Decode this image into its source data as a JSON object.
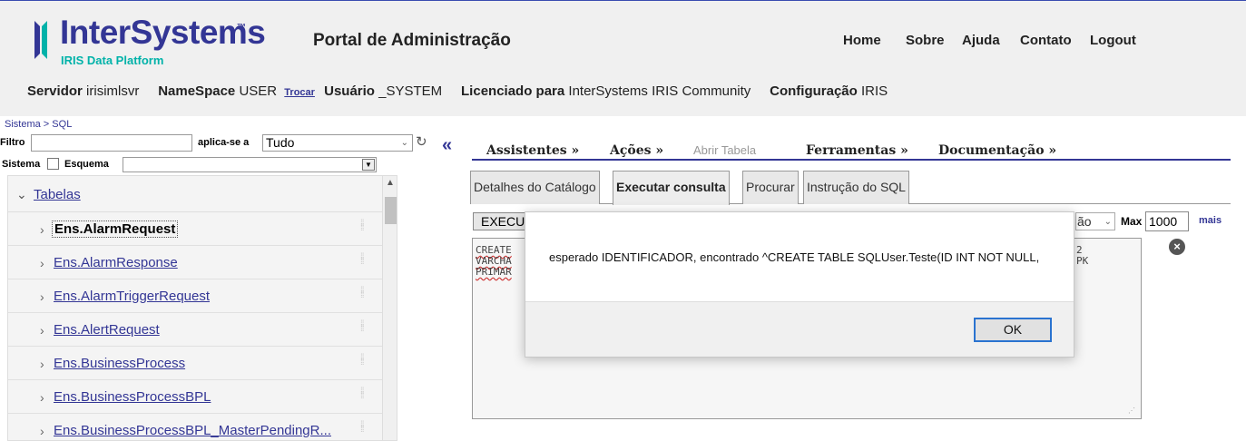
{
  "header": {
    "logo_text": "InterSystems",
    "logo_tm": "™",
    "logo_sub": "IRIS Data Platform",
    "portal_title": "Portal de Administração",
    "nav": [
      "Home",
      "Sobre",
      "Ajuda",
      "Contato",
      "Logout"
    ]
  },
  "infobar": {
    "servidor_label": "Servidor",
    "servidor_value": "irisimlsvr",
    "namespace_label": "NameSpace",
    "namespace_value": "USER",
    "trocar_label": "Trocar",
    "usuario_label": "Usuário",
    "usuario_value": "_SYSTEM",
    "licenciado_label": "Licenciado para",
    "licenciado_value": "InterSystems IRIS Community",
    "config_label": "Configuração",
    "config_value": "IRIS"
  },
  "breadcrumb": {
    "root": "Sistema",
    "sep": " > ",
    "current": "SQL"
  },
  "filter": {
    "filtro_label": "Filtro",
    "filtro_value": "",
    "aplica_label": "aplica-se a",
    "aplica_value": "Tudo",
    "sistema_label": "Sistema",
    "sistema_checked": false,
    "esquema_label": "Esquema",
    "esquema_value": ""
  },
  "tree": {
    "group_label": "Tabelas",
    "items": [
      "Ens.AlarmRequest",
      "Ens.AlarmResponse",
      "Ens.AlarmTriggerRequest",
      "Ens.AlertRequest",
      "Ens.BusinessProcess",
      "Ens.BusinessProcessBPL",
      "Ens.BusinessProcessBPL_MasterPendingR..."
    ],
    "selected_index": 0
  },
  "actionbar": {
    "assistentes": "Assistentes »",
    "acoes": "Ações »",
    "abrir_tabela": "Abrir Tabela",
    "ferramentas": "Ferramentas »",
    "documentacao": "Documentação »"
  },
  "tabs": [
    "Detalhes do Catálogo",
    "Executar consulta",
    "Procurar",
    "Instrução do SQL"
  ],
  "active_tab": 1,
  "query": {
    "execute_label": "EXECU",
    "rowlimit_visible": "ão",
    "max_label": "Max",
    "max_value": "1000",
    "mais_label": "mais",
    "sql_lines_left": [
      "CREATE",
      "VARCHA",
      "PRIMAR"
    ],
    "sql_lines_right": [
      "2",
      "PK"
    ]
  },
  "modal": {
    "message": "esperado IDENTIFICADOR, encontrado ^CREATE TABLE SQLUser.Teste(ID INT NOT NULL,",
    "ok_label": "OK"
  },
  "colors": {
    "brand_blue": "#333695",
    "brand_teal": "#00b2a9"
  }
}
